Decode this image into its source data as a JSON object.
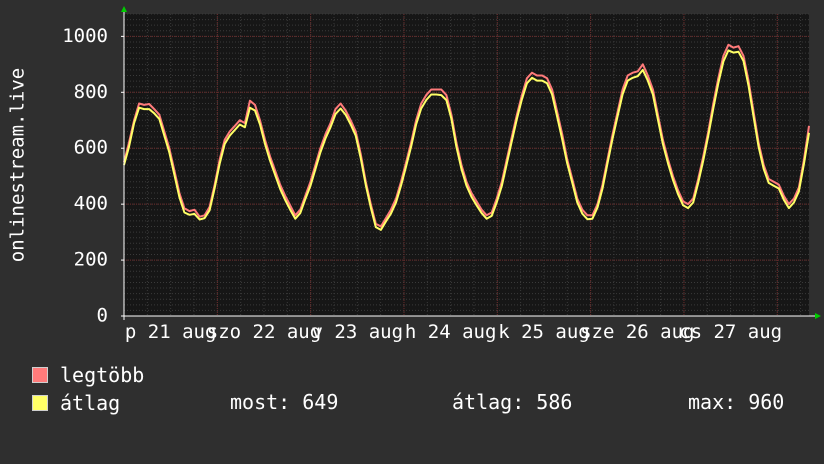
{
  "colors": {
    "background": "#2f2f2f",
    "canvas": "#161616",
    "max_series": "#ff7b7b",
    "avg_series": "#ffff66",
    "axis_arrow": "#00cc00",
    "grid_minor": "#3a3a3a",
    "grid_major": "#6b2a2a"
  },
  "chart_data": {
    "type": "line",
    "ylabel": "onlinestream.live",
    "ylim": [
      0,
      1080
    ],
    "yticks": [
      0,
      200,
      400,
      600,
      800,
      1000
    ],
    "xlabels": [
      "p 21 aug",
      "szo 22 aug",
      "v 23 aug",
      "h 24 aug",
      "k 25 aug",
      "sze 26 aug",
      "cs 27 aug"
    ],
    "grid": true,
    "x_days": 7.34,
    "series": [
      {
        "name": "legtöbb",
        "color_key": "max_series",
        "values": [
          550,
          620,
          700,
          760,
          755,
          758,
          740,
          720,
          660,
          600,
          520,
          440,
          385,
          375,
          380,
          355,
          360,
          390,
          470,
          560,
          630,
          660,
          680,
          700,
          690,
          770,
          755,
          700,
          630,
          570,
          520,
          470,
          430,
          395,
          360,
          380,
          430,
          480,
          540,
          600,
          650,
          690,
          740,
          760,
          735,
          700,
          660,
          580,
          480,
          400,
          330,
          320,
          350,
          380,
          420,
          480,
          550,
          620,
          700,
          760,
          790,
          810,
          810,
          810,
          790,
          720,
          620,
          540,
          480,
          440,
          410,
          380,
          360,
          370,
          420,
          480,
          560,
          640,
          720,
          790,
          850,
          870,
          860,
          860,
          850,
          810,
          730,
          650,
          560,
          490,
          420,
          380,
          360,
          360,
          400,
          470,
          560,
          650,
          730,
          810,
          860,
          870,
          875,
          900,
          860,
          810,
          720,
          630,
          560,
          500,
          450,
          410,
          400,
          420,
          490,
          570,
          660,
          760,
          850,
          930,
          970,
          960,
          965,
          930,
          840,
          730,
          620,
          540,
          490,
          480,
          470,
          430,
          400,
          420,
          460,
          560,
          680
        ]
      },
      {
        "name": "átlag",
        "color_key": "avg_series",
        "values": [
          540,
          605,
          690,
          745,
          740,
          740,
          725,
          705,
          645,
          585,
          505,
          425,
          370,
          362,
          365,
          345,
          350,
          378,
          458,
          545,
          615,
          645,
          665,
          685,
          675,
          745,
          735,
          685,
          615,
          555,
          505,
          455,
          415,
          380,
          348,
          368,
          418,
          465,
          525,
          585,
          635,
          675,
          722,
          742,
          720,
          685,
          645,
          565,
          468,
          388,
          318,
          308,
          338,
          366,
          406,
          466,
          535,
          605,
          685,
          742,
          772,
          792,
          792,
          790,
          772,
          705,
          605,
          525,
          466,
          426,
          396,
          368,
          348,
          358,
          406,
          465,
          545,
          625,
          705,
          775,
          832,
          852,
          842,
          842,
          832,
          792,
          712,
          632,
          546,
          476,
          406,
          366,
          346,
          348,
          388,
          456,
          546,
          635,
          715,
          793,
          842,
          852,
          858,
          880,
          842,
          792,
          703,
          615,
          546,
          486,
          436,
          396,
          386,
          406,
          476,
          555,
          645,
          742,
          832,
          910,
          950,
          942,
          945,
          912,
          822,
          712,
          605,
          526,
          476,
          466,
          456,
          416,
          386,
          406,
          446,
          545,
          655
        ]
      }
    ]
  },
  "legend": [
    {
      "key": "max_series",
      "label": "legtöbb"
    },
    {
      "key": "avg_series",
      "label": "átlag"
    }
  ],
  "stats": {
    "most": "most: 649",
    "atlag": "átlag: 586",
    "max": "max: 960"
  }
}
